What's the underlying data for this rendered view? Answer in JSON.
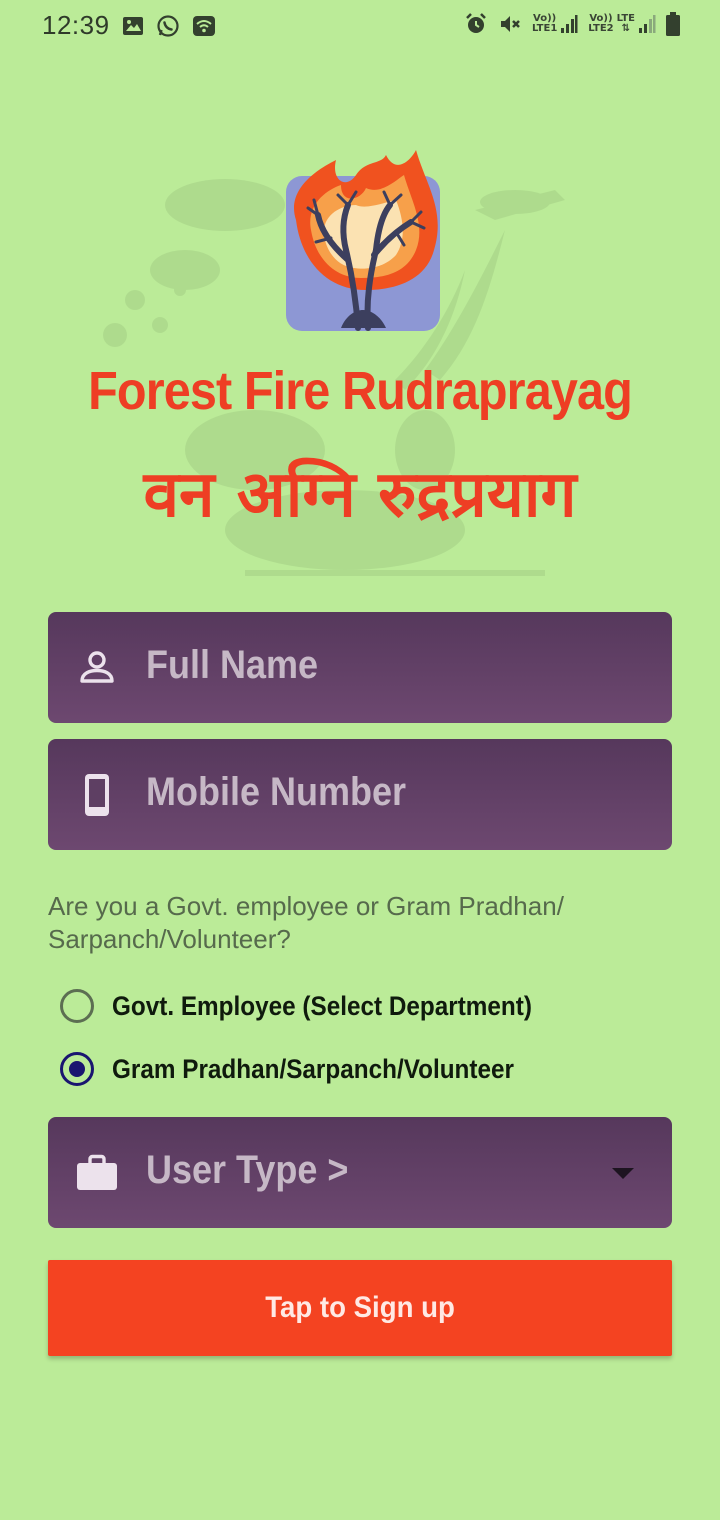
{
  "status_bar": {
    "time": "12:39",
    "left_icons": [
      "image-icon",
      "whatsapp-icon",
      "wifi-icon"
    ],
    "right_icons": [
      "alarm-icon",
      "mute-icon",
      "signal-icon",
      "signal-icon",
      "battery-icon"
    ],
    "sim1_label_top": "Vo))",
    "sim1_label_bottom": "LTE1",
    "sim2_label_top": "Vo))",
    "sim2_label_bottom": "LTE2",
    "lte_label": "LTE"
  },
  "header": {
    "title_en": "Forest Fire Rudraprayag",
    "title_hi": "वन अग्नि रुद्रप्रयाग",
    "logo_icon": "burning-tree-logo"
  },
  "form": {
    "full_name": {
      "placeholder": "Full Name",
      "value": "",
      "icon": "person-icon"
    },
    "mobile": {
      "placeholder": "Mobile Number",
      "value": "",
      "icon": "phone-icon"
    },
    "question": "Are you a Govt. employee or Gram Pradhan/ Sarpanch/Volunteer?",
    "options": [
      {
        "label": "Govt. Employee (Select Department)",
        "selected": false
      },
      {
        "label": "Gram Pradhan/Sarpanch/Volunteer",
        "selected": true
      }
    ],
    "user_type": {
      "placeholder": "User Type >",
      "icon": "briefcase-icon",
      "dropdown_icon": "caret-down-icon"
    },
    "submit_label": "Tap to Sign up"
  },
  "colors": {
    "background": "#bbeb98",
    "title": "#ee3e24",
    "field": "#5e3f63",
    "button": "#f44321",
    "radio_selected": "#1a1570"
  }
}
